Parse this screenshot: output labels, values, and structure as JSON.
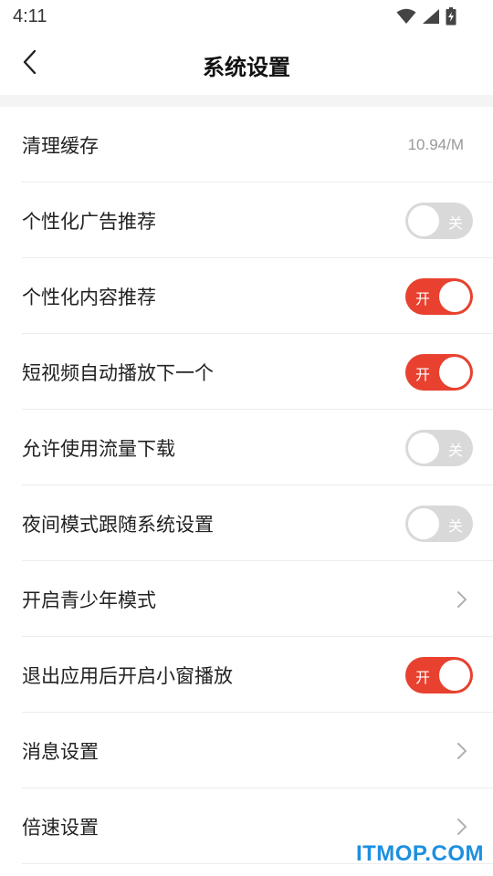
{
  "status_bar": {
    "time": "4:11",
    "icons": [
      "wifi-icon",
      "cell-signal-icon",
      "battery-charging-icon"
    ]
  },
  "nav": {
    "title": "系统设置",
    "back_icon": "chevron-left-icon"
  },
  "colors": {
    "accent": "#e8412f",
    "toggle_off": "#d9d9d9",
    "watermark": "#1d8fe0"
  },
  "settings": [
    {
      "label": "清理缓存",
      "type": "value",
      "value": "10.94/M"
    },
    {
      "label": "个性化广告推荐",
      "type": "toggle",
      "on": false,
      "state_text": "关"
    },
    {
      "label": "个性化内容推荐",
      "type": "toggle",
      "on": true,
      "state_text": "开"
    },
    {
      "label": "短视频自动播放下一个",
      "type": "toggle",
      "on": true,
      "state_text": "开"
    },
    {
      "label": "允许使用流量下载",
      "type": "toggle",
      "on": false,
      "state_text": "关"
    },
    {
      "label": "夜间模式跟随系统设置",
      "type": "toggle",
      "on": false,
      "state_text": "关"
    },
    {
      "label": "开启青少年模式",
      "type": "link"
    },
    {
      "label": "退出应用后开启小窗播放",
      "type": "toggle",
      "on": true,
      "state_text": "开"
    },
    {
      "label": "消息设置",
      "type": "link"
    },
    {
      "label": "倍速设置",
      "type": "link"
    }
  ],
  "watermark": "ITMOP.COM"
}
